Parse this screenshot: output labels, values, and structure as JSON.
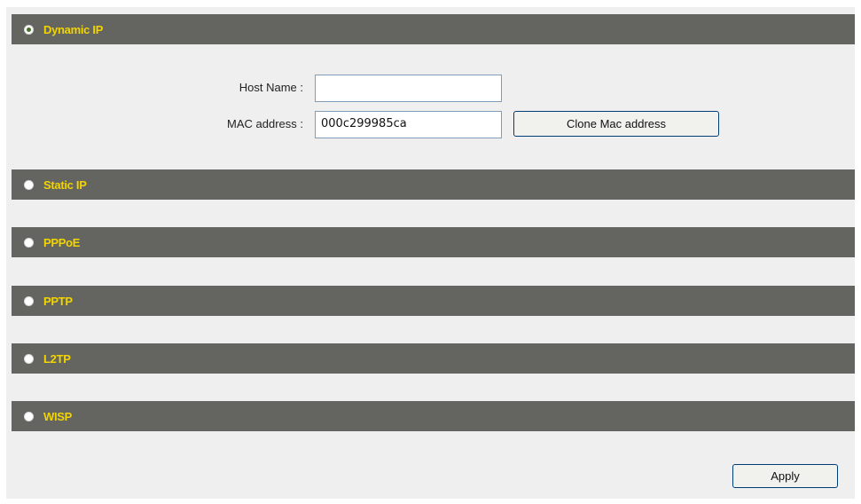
{
  "sections": {
    "dynamic_ip": {
      "label": "Dynamic IP",
      "selected": true
    },
    "static_ip": {
      "label": "Static IP",
      "selected": false
    },
    "pppoe": {
      "label": "PPPoE",
      "selected": false
    },
    "pptp": {
      "label": "PPTP",
      "selected": false
    },
    "l2tp": {
      "label": "L2TP",
      "selected": false
    },
    "wisp": {
      "label": "WISP",
      "selected": false
    }
  },
  "dynamic_form": {
    "host_name_label": "Host Name :",
    "host_name_value": "",
    "mac_label": "MAC address :",
    "mac_value": "000c299985ca",
    "clone_button": "Clone Mac address"
  },
  "apply_button": "Apply",
  "colors": {
    "bar_bg": "#646561",
    "bar_label": "#f2d400",
    "panel_bg": "#efefef"
  }
}
